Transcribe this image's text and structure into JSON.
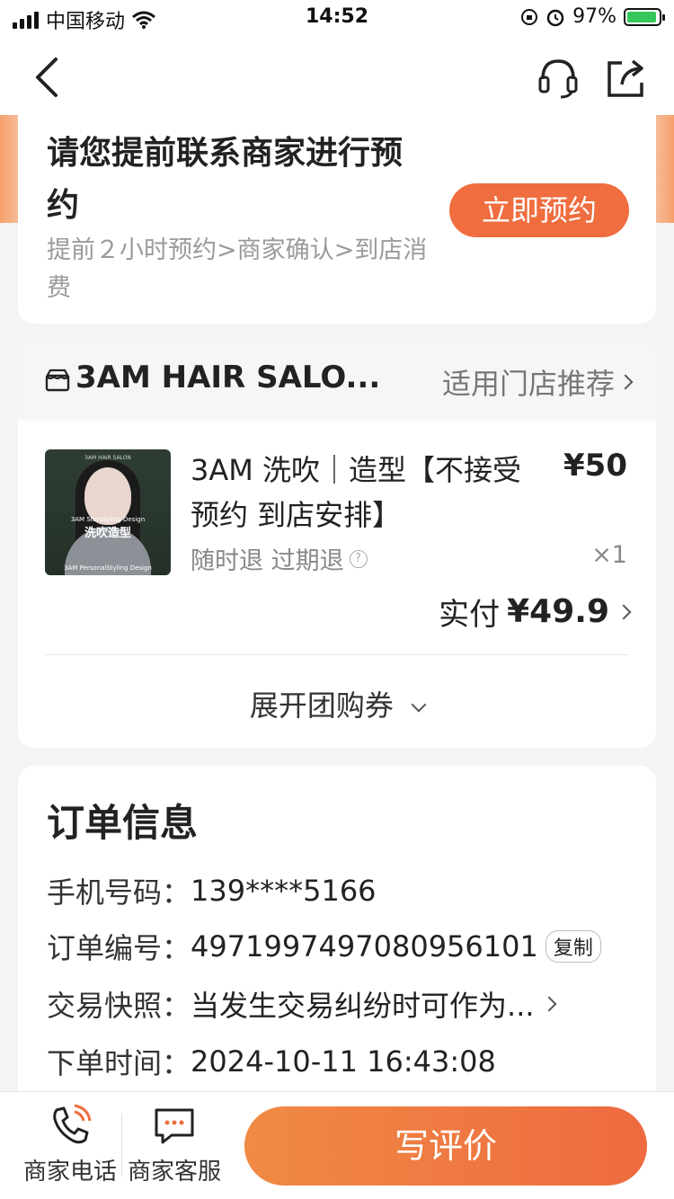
{
  "status_bar": {
    "carrier": "中国移动",
    "time": "14:52",
    "battery": "97%",
    "battery_level": 0.97
  },
  "nav": {
    "back_icon": "chevron-left-icon",
    "service_icon": "headset-icon",
    "share_icon": "share-icon"
  },
  "booking": {
    "title": "请您提前联系商家进行预约",
    "steps": "提前２小时预约>商家确认>到店消费",
    "button": "立即预约",
    "accent": "#ef6d3f"
  },
  "product": {
    "shop_name": "3AM HAIR SALO...",
    "store_link": "适用门店推荐",
    "thumb_top": "3AM HAIR SALON",
    "thumb_main": "洗吹造型",
    "thumb_sub": "3AM StarStyling Design",
    "thumb_bottom": "3AM PersonalStyling Design",
    "name": "3AM 洗吹｜造型【不接受预约 到店安排】",
    "price": "¥50",
    "refund": "随时退 过期退",
    "qty": "×1",
    "paid_label": "实付",
    "paid_value": "¥49.9",
    "expand": "展开团购券"
  },
  "order": {
    "heading": "订单信息",
    "phone_label": "手机号码：",
    "phone_value": "139****5166",
    "order_no_label": "订单编号：",
    "order_no_value": "4971997497080956101",
    "copy": "复制",
    "snapshot_label": "交易快照：",
    "snapshot_value": "当发生交易纠纷时可作为...",
    "time_label": "下单时间：",
    "time_value": "2024-10-11 16:43:08"
  },
  "bottom_bar": {
    "phone": "商家电话",
    "service": "商家客服",
    "review": "写评价"
  }
}
